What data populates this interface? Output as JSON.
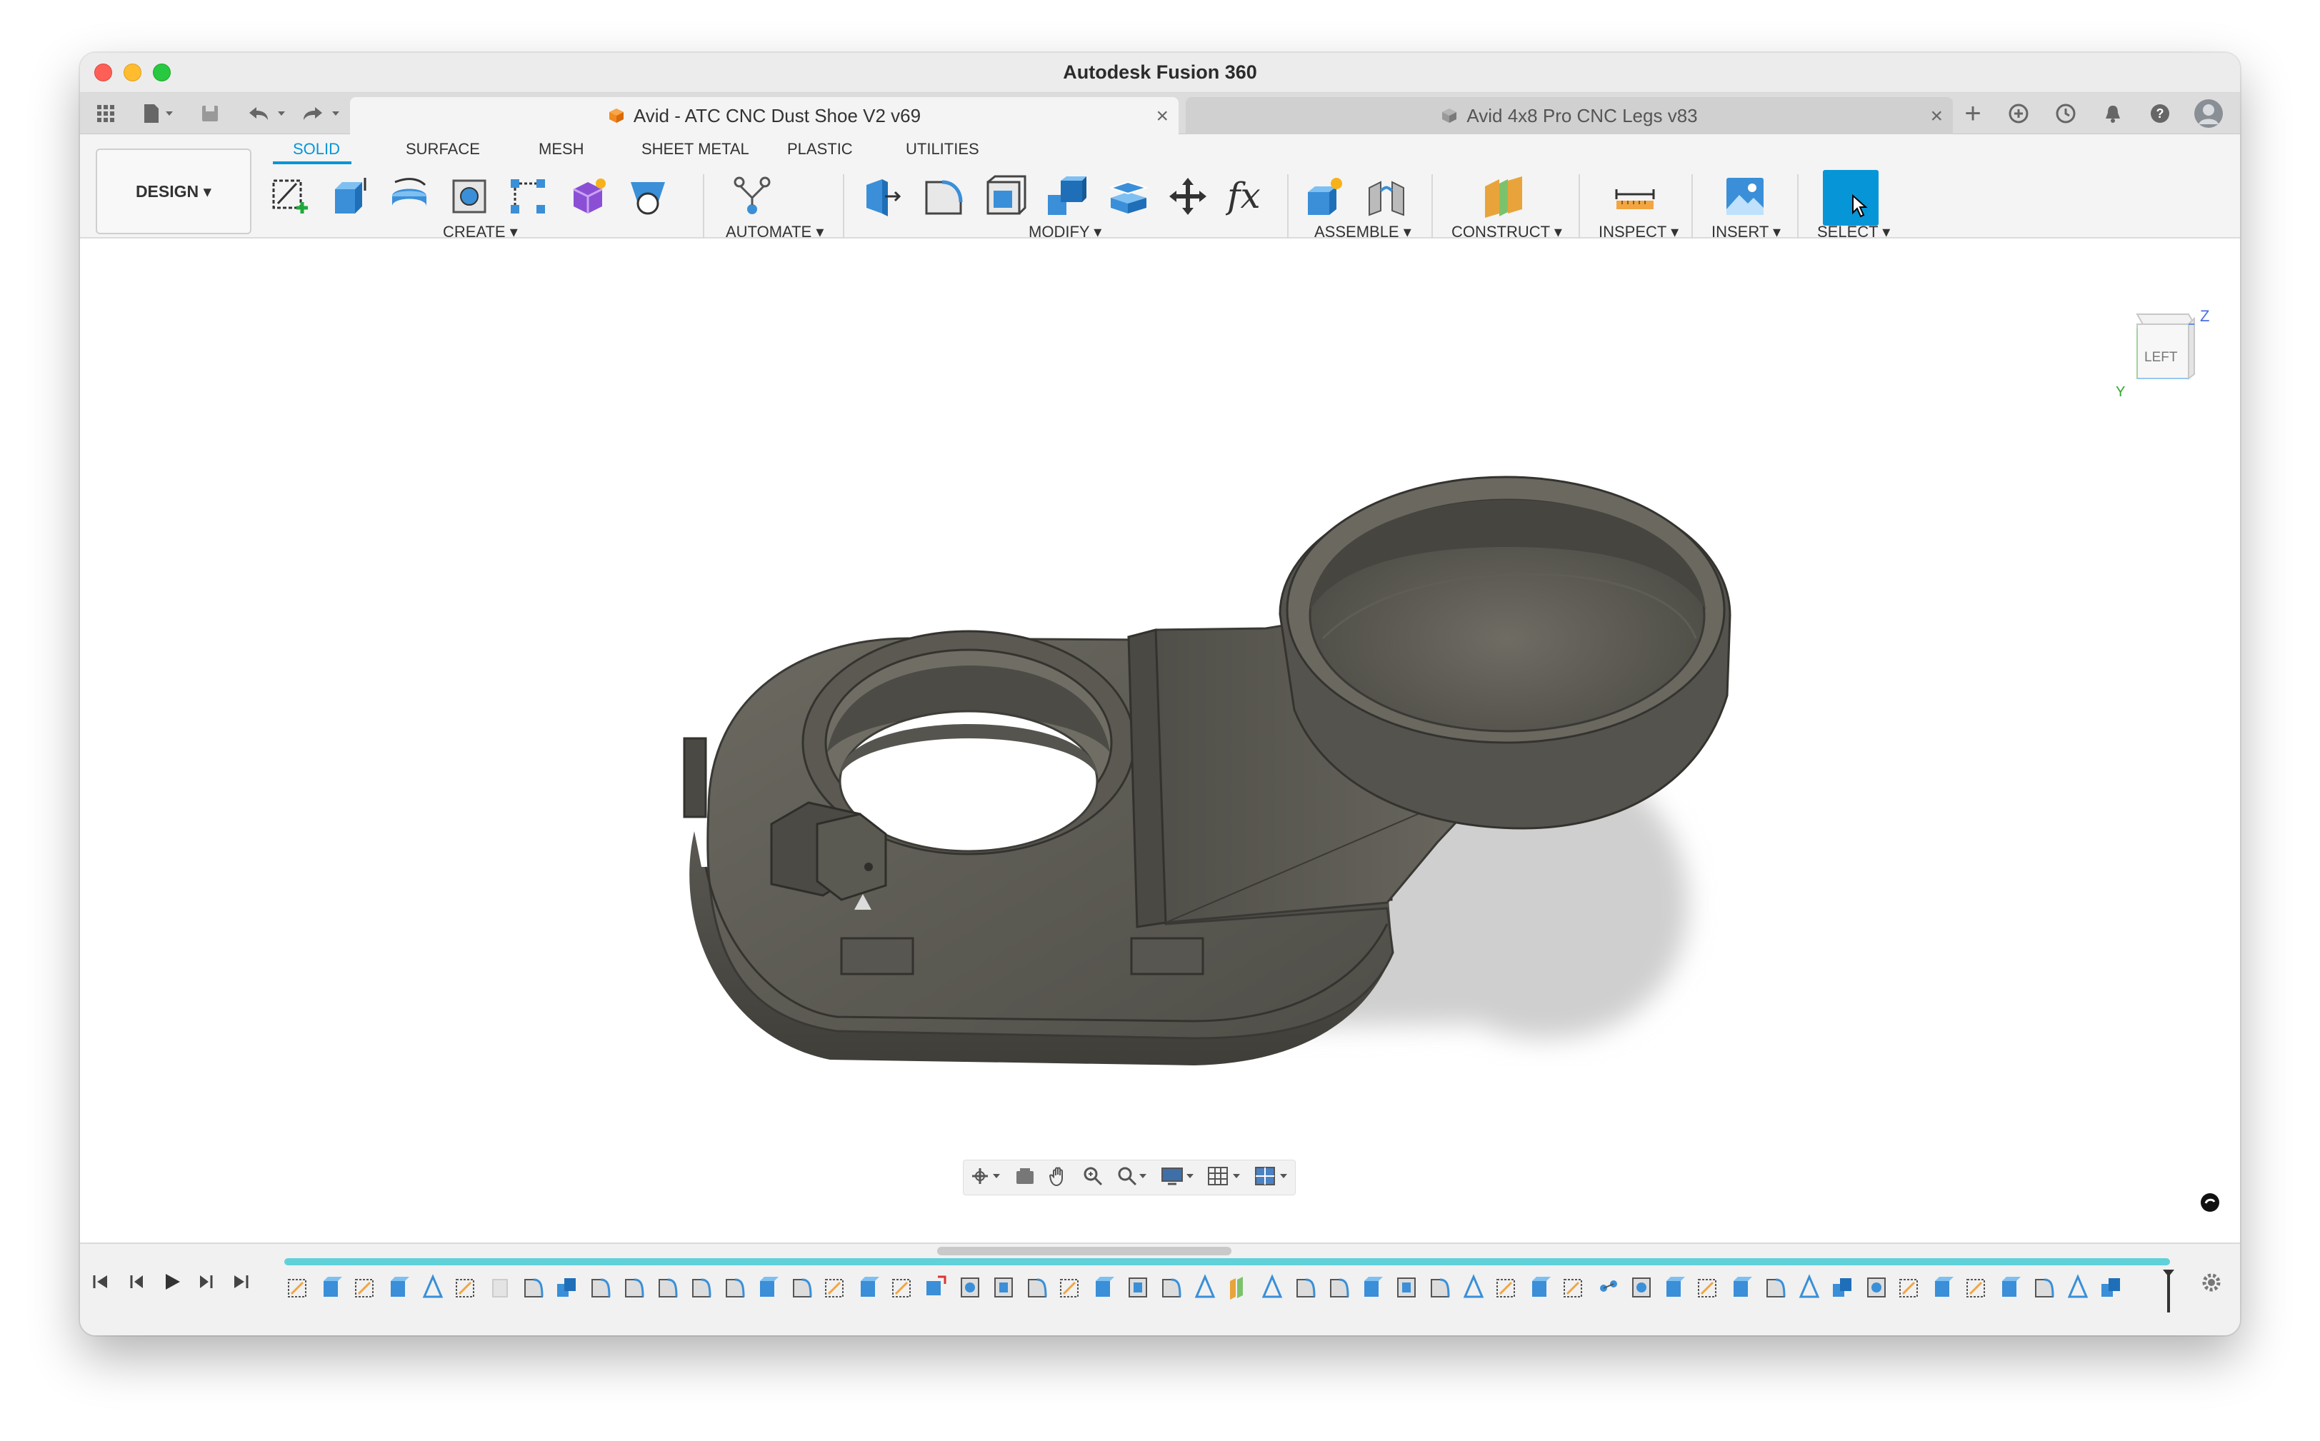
{
  "window": {
    "title": "Autodesk Fusion 360"
  },
  "tabs": [
    {
      "label": "Avid - ATC CNC Dust Shoe V2 v69",
      "active": true
    },
    {
      "label": "Avid 4x8 Pro CNC Legs v83",
      "active": false
    }
  ],
  "workspace": {
    "label": "DESIGN"
  },
  "workspace_tabs": [
    {
      "label": "SOLID",
      "active": true
    },
    {
      "label": "SURFACE"
    },
    {
      "label": "MESH"
    },
    {
      "label": "SHEET METAL"
    },
    {
      "label": "PLASTIC"
    },
    {
      "label": "UTILITIES"
    }
  ],
  "toolbar_groups": [
    {
      "label": "CREATE"
    },
    {
      "label": "AUTOMATE"
    },
    {
      "label": "MODIFY"
    },
    {
      "label": "ASSEMBLE"
    },
    {
      "label": "CONSTRUCT"
    },
    {
      "label": "INSPECT"
    },
    {
      "label": "INSERT"
    },
    {
      "label": "SELECT"
    }
  ],
  "viewcube": {
    "face": "LEFT",
    "axis_z": "Z",
    "axis_y": "Y"
  },
  "colors": {
    "accent": "#0696d7",
    "model": "#5c5a53",
    "timeline_bar": "#5fd1d9"
  }
}
